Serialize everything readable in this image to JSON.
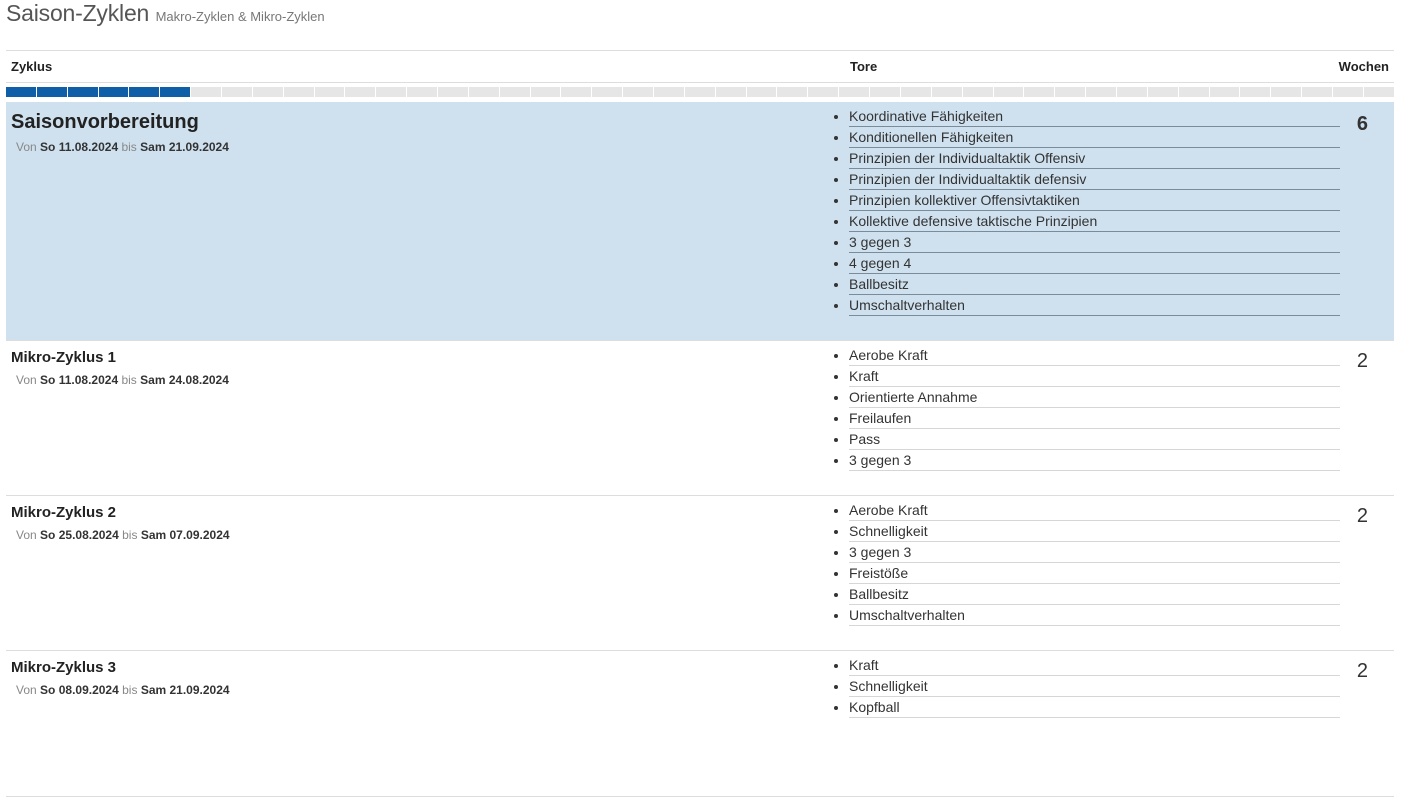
{
  "header": {
    "title": "Saison-Zyklen",
    "subtitle": "Makro-Zyklen & Mikro-Zyklen"
  },
  "table": {
    "columns": {
      "cycle": "Zyklus",
      "goals": "Tore",
      "weeks": "Wochen"
    },
    "progress": {
      "filled_segments": 6,
      "total_segments": 45,
      "color": "#0f5fa8"
    },
    "rows": [
      {
        "type": "macro",
        "name": "Saisonvorbereitung",
        "from_label": "Von",
        "from": "So 11.08.2024",
        "to_label": "bis",
        "to": "Sam 21.09.2024",
        "goals": [
          "Koordinative Fähigkeiten",
          "Konditionellen Fähigkeiten",
          "Prinzipien der Individualtaktik Offensiv",
          "Prinzipien der Individualtaktik defensiv",
          "Prinzipien kollektiver Offensivtaktiken",
          "Kollektive defensive taktische Prinzipien",
          "3 gegen 3",
          "4 gegen 4",
          "Ballbesitz",
          "Umschaltverhalten"
        ],
        "weeks": "6"
      },
      {
        "type": "micro",
        "name": "Mikro-Zyklus 1",
        "from_label": "Von",
        "from": "So 11.08.2024",
        "to_label": "bis",
        "to": "Sam 24.08.2024",
        "goals": [
          "Aerobe Kraft",
          "Kraft",
          "Orientierte Annahme",
          "Freilaufen",
          "Pass",
          "3 gegen 3"
        ],
        "weeks": "2"
      },
      {
        "type": "micro",
        "name": "Mikro-Zyklus 2",
        "from_label": "Von",
        "from": "So 25.08.2024",
        "to_label": "bis",
        "to": "Sam 07.09.2024",
        "goals": [
          "Aerobe Kraft",
          "Schnelligkeit",
          "3 gegen 3",
          "Freistöße",
          "Ballbesitz",
          "Umschaltverhalten"
        ],
        "weeks": "2"
      },
      {
        "type": "micro",
        "name": "Mikro-Zyklus 3",
        "from_label": "Von",
        "from": "So 08.09.2024",
        "to_label": "bis",
        "to": "Sam 21.09.2024",
        "goals": [
          "Kraft",
          "Schnelligkeit",
          "Kopfball"
        ],
        "weeks": "2"
      }
    ]
  }
}
